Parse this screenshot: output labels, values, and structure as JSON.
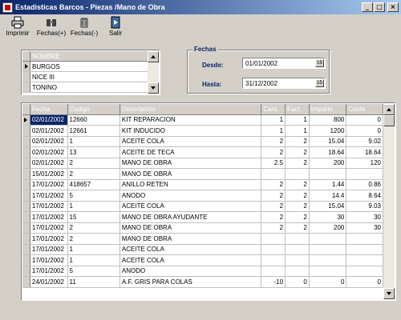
{
  "window": {
    "title": "Estadisticas Barcos - Piezas /Mano de Obra",
    "min": "_",
    "max": "□",
    "close": "×"
  },
  "toolbar": [
    {
      "label": "Imprimir",
      "icon": "printer-icon"
    },
    {
      "label": "Fechas(+)",
      "icon": "binoculars-icon"
    },
    {
      "label": "Fechas(-)",
      "icon": "trash-icon"
    },
    {
      "label": "Salir",
      "icon": "exit-icon"
    }
  ],
  "names": {
    "header": "NOMBRE",
    "items": [
      "BURGOS",
      "NICE III",
      "TONINO"
    ]
  },
  "fechas": {
    "legend": "Fechas",
    "desde_label": "Desde:",
    "desde_value": "01/01/2002",
    "hasta_label": "Hasta:",
    "hasta_value": "31/12/2002"
  },
  "grid": {
    "columns": [
      "Fecha",
      "Codigo",
      "Descripcion",
      "Cant.",
      "Fact.",
      "Importe",
      "Coste"
    ],
    "rows": [
      [
        "02/01/2002",
        "12660",
        "KIT REPARACION",
        "1",
        "1",
        "800",
        "0"
      ],
      [
        "02/01/2002",
        "12661",
        "KIT INDUCIDO",
        "1",
        "1",
        "1200",
        "0"
      ],
      [
        "02/01/2002",
        "1",
        "ACEITE COLA",
        "2",
        "2",
        "15.04",
        "9.02"
      ],
      [
        "02/01/2002",
        "13",
        "ACEITE DE TECA",
        "2",
        "2",
        "18.64",
        "18.64"
      ],
      [
        "02/01/2002",
        "2",
        "MANO DE OBRA",
        "2.5",
        "2",
        "200",
        "120"
      ],
      [
        "15/01/2002",
        "2",
        "MANO DE OBRA",
        "",
        "",
        "",
        ""
      ],
      [
        "17/01/2002",
        "418657",
        "ANILLO RETEN",
        "2",
        "2",
        "1.44",
        "0.86"
      ],
      [
        "17/01/2002",
        "5",
        "ANODO",
        "2",
        "2",
        "14.4",
        "8.64"
      ],
      [
        "17/01/2002",
        "1",
        "ACEITE COLA",
        "2",
        "2",
        "15.04",
        "9.03"
      ],
      [
        "17/01/2002",
        "15",
        "MANO DE OBRA AYUDANTE",
        "2",
        "2",
        "30",
        "30"
      ],
      [
        "17/01/2002",
        "2",
        "MANO DE OBRA",
        "2",
        "2",
        "200",
        "30"
      ],
      [
        "17/01/2002",
        "2",
        "MANO DE OBRA",
        "",
        "",
        "",
        ""
      ],
      [
        "17/01/2002",
        "1",
        "ACEITE COLA",
        "",
        "",
        "",
        ""
      ],
      [
        "17/01/2002",
        "1",
        "ACEITE COLA",
        "",
        "",
        "",
        ""
      ],
      [
        "17/01/2002",
        "5",
        "ANODO",
        "",
        "",
        "",
        ""
      ],
      [
        "24/01/2002",
        "11",
        "A.F. GRIS PARA COLAS",
        "-10",
        "0",
        "0",
        "0"
      ]
    ]
  }
}
